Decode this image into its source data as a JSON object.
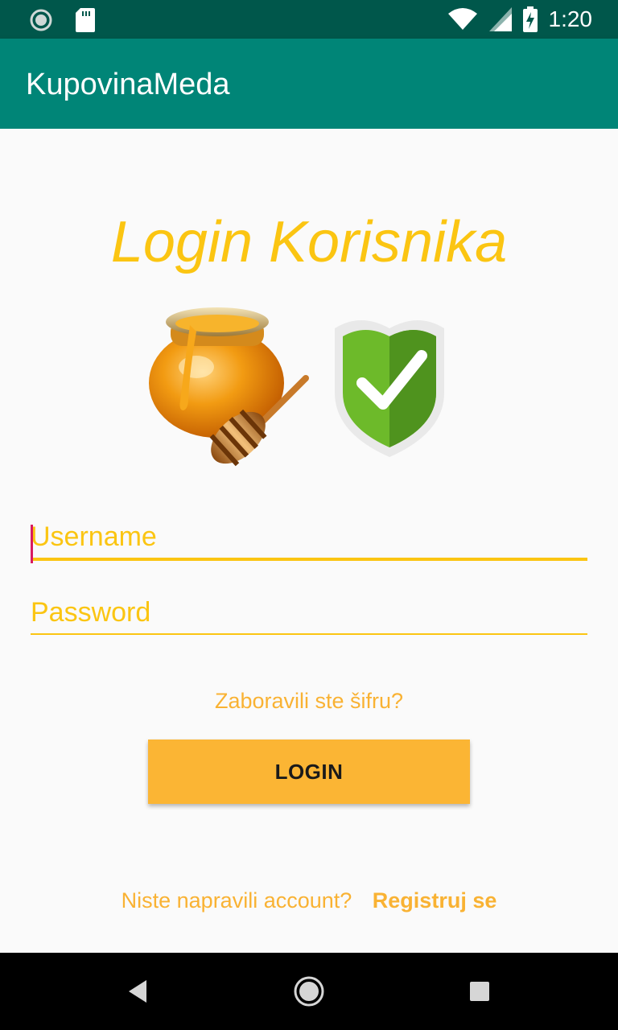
{
  "status_bar": {
    "time": "1:20",
    "icons": [
      "loading-circle-icon",
      "sd-card-icon",
      "wifi-icon",
      "cell-signal-icon",
      "battery-charging-icon"
    ]
  },
  "app_bar": {
    "title": "KupovinaMeda"
  },
  "login": {
    "heading": "Login Korisnika",
    "username_placeholder": "Username",
    "username_value": "",
    "password_placeholder": "Password",
    "password_value": "",
    "forgot_password": "Zaboravili ste šifru?",
    "login_button": "LOGIN",
    "no_account_text": "Niste napravili account?",
    "register_link": "Registruj se"
  },
  "illustration": {
    "icons": [
      "honey-pot-icon",
      "security-shield-check-icon"
    ]
  },
  "nav_bar": {
    "icons": [
      "back-icon",
      "home-icon",
      "recents-icon"
    ]
  },
  "colors": {
    "status_bar": "#00574b",
    "app_bar": "#008577",
    "accent_yellow": "#fbc512",
    "button": "#fbb534",
    "cursor": "#d81b60"
  }
}
